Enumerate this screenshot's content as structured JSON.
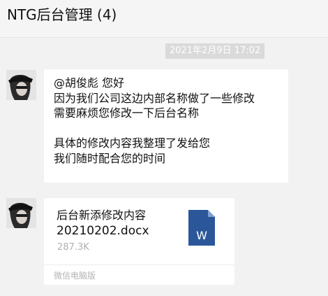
{
  "chat": {
    "title": "NTG后台管理 (4)"
  },
  "messages": {
    "timestamp": "2021年2月9日 17:02",
    "text_message": {
      "lines": [
        "@胡俊彪  您好",
        "因为我们公司这边内部名称做了一些修改",
        "需要麻烦您修改一下后台名称",
        "",
        "具体的修改内容我整理了发给您",
        "我们随时配合您的时间"
      ]
    },
    "file_message": {
      "name_line1": "后台新添修改内容",
      "name_line2": "20210202.docx",
      "size": "287.3K",
      "icon_letter": "W",
      "icon": "word-document-icon",
      "source": "微信电脑版"
    }
  },
  "colors": {
    "background": "#f2f2f2",
    "bubble": "#ffffff",
    "word_blue": "#2b579a",
    "timestamp_bg": "#dadada"
  }
}
